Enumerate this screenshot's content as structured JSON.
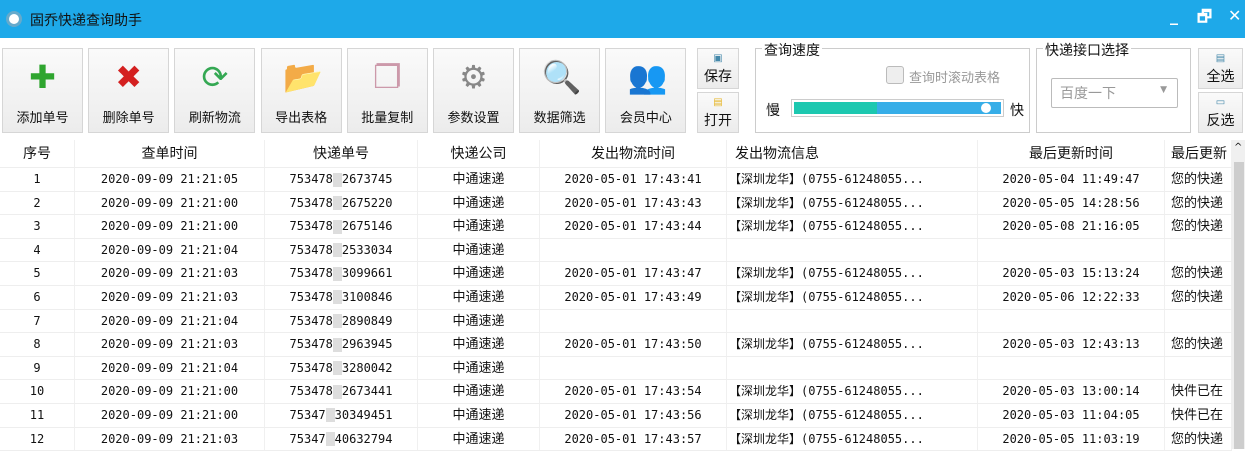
{
  "title": "固乔快递查询助手",
  "window_controls": {
    "minimize": "_",
    "restore": "🗗",
    "close": "✕"
  },
  "toolbar": [
    {
      "label": "添加单号",
      "icon": "plus-icon",
      "glyph": "✚",
      "color": "#2fa52f"
    },
    {
      "label": "删除单号",
      "icon": "delete-icon",
      "glyph": "✖",
      "color": "#d42020"
    },
    {
      "label": "刷新物流",
      "icon": "refresh-icon",
      "glyph": "⟳",
      "color": "#34a853"
    },
    {
      "label": "导出表格",
      "icon": "export-folder-icon",
      "glyph": "📂",
      "color": "#e6b422"
    },
    {
      "label": "批量复制",
      "icon": "copy-icon",
      "glyph": "❐",
      "color": "#c9a"
    },
    {
      "label": "参数设置",
      "icon": "gear-icon",
      "glyph": "⚙",
      "color": "#888"
    },
    {
      "label": "数据筛选",
      "icon": "filter-search-icon",
      "glyph": "🔍",
      "color": "#e6b422"
    },
    {
      "label": "会员中心",
      "icon": "members-icon",
      "glyph": "👥",
      "color": "#c44"
    }
  ],
  "save_label": "保存",
  "open_label": "打开",
  "speed": {
    "title": "查询速度",
    "scroll_checkbox": "查询时滚动表格",
    "slow": "慢",
    "fast": "快",
    "value_percent": 96,
    "colors": {
      "fill": "#1dc8b0",
      "track": "#37aee8"
    }
  },
  "api": {
    "title": "快递接口选择",
    "selected": "百度一下"
  },
  "select_all": "全选",
  "invert_select": "反选",
  "columns": [
    "序号",
    "查单时间",
    "快递单号",
    "快递公司",
    "发出物流时间",
    "发出物流信息",
    "最后更新时间",
    "最后更新"
  ],
  "rows": [
    [
      "1",
      "2020-09-09 21:21:05",
      "753478",
      "2673745",
      "中通速递",
      "2020-05-01 17:43:41",
      "【深圳龙华】(0755-61248055...",
      "2020-05-04 11:49:47",
      "您的快递"
    ],
    [
      "2",
      "2020-09-09 21:21:00",
      "753478",
      "2675220",
      "中通速递",
      "2020-05-01 17:43:43",
      "【深圳龙华】(0755-61248055...",
      "2020-05-05 14:28:56",
      "您的快递"
    ],
    [
      "3",
      "2020-09-09 21:21:00",
      "753478",
      "2675146",
      "中通速递",
      "2020-05-01 17:43:44",
      "【深圳龙华】(0755-61248055...",
      "2020-05-08 21:16:05",
      "您的快递"
    ],
    [
      "4",
      "2020-09-09 21:21:04",
      "753478",
      "2533034",
      "中通速递",
      "",
      "",
      "",
      ""
    ],
    [
      "5",
      "2020-09-09 21:21:03",
      "753478",
      "3099661",
      "中通速递",
      "2020-05-01 17:43:47",
      "【深圳龙华】(0755-61248055...",
      "2020-05-03 15:13:24",
      "您的快递"
    ],
    [
      "6",
      "2020-09-09 21:21:03",
      "753478",
      "3100846",
      "中通速递",
      "2020-05-01 17:43:49",
      "【深圳龙华】(0755-61248055...",
      "2020-05-06 12:22:33",
      "您的快递"
    ],
    [
      "7",
      "2020-09-09 21:21:04",
      "753478",
      "2890849",
      "中通速递",
      "",
      "",
      "",
      ""
    ],
    [
      "8",
      "2020-09-09 21:21:03",
      "753478",
      "2963945",
      "中通速递",
      "2020-05-01 17:43:50",
      "【深圳龙华】(0755-61248055...",
      "2020-05-03 12:43:13",
      "您的快递"
    ],
    [
      "9",
      "2020-09-09 21:21:04",
      "753478",
      "3280042",
      "中通速递",
      "",
      "",
      "",
      ""
    ],
    [
      "10",
      "2020-09-09 21:21:00",
      "753478",
      "2673441",
      "中通速递",
      "2020-05-01 17:43:54",
      "【深圳龙华】(0755-61248055...",
      "2020-05-03 13:00:14",
      "快件已在"
    ],
    [
      "11",
      "2020-09-09 21:21:00",
      "75347",
      "30349451",
      "中通速递",
      "2020-05-01 17:43:56",
      "【深圳龙华】(0755-61248055...",
      "2020-05-03 11:04:05",
      "快件已在"
    ],
    [
      "12",
      "2020-09-09 21:21:03",
      "75347",
      "40632794",
      "中通速递",
      "2020-05-01 17:43:57",
      "【深圳龙华】(0755-61248055...",
      "2020-05-05 11:03:19",
      "您的快递"
    ]
  ]
}
